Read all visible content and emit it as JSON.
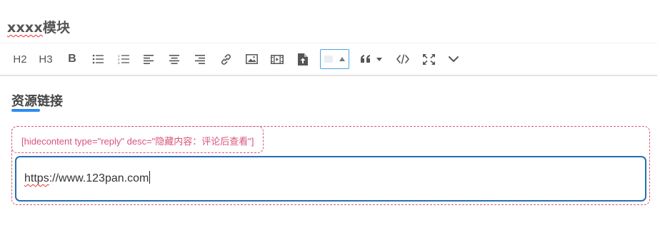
{
  "module": {
    "title_prefix": "xxxx",
    "title_suffix": "模块"
  },
  "toolbar": {
    "h2": "H2",
    "h3": "H3",
    "bold": "B",
    "items": [
      "heading-2",
      "heading-3",
      "bold",
      "bulleted-list",
      "numbered-list",
      "align-left",
      "align-center",
      "align-right",
      "link",
      "image",
      "video",
      "file-upload",
      "color-picker",
      "quote",
      "code",
      "fullscreen",
      "more"
    ]
  },
  "section": {
    "title": "资源链接"
  },
  "shortcode": {
    "text": "[hidecontent type=\"reply\" desc=\"隐藏内容：评论后查看\"]"
  },
  "link": {
    "prefix": "https",
    "rest": "://www.123pan.com"
  },
  "colors": {
    "accent": "#2d8cf0",
    "input_border": "#2470b3",
    "shortcode": "#d9537a"
  }
}
